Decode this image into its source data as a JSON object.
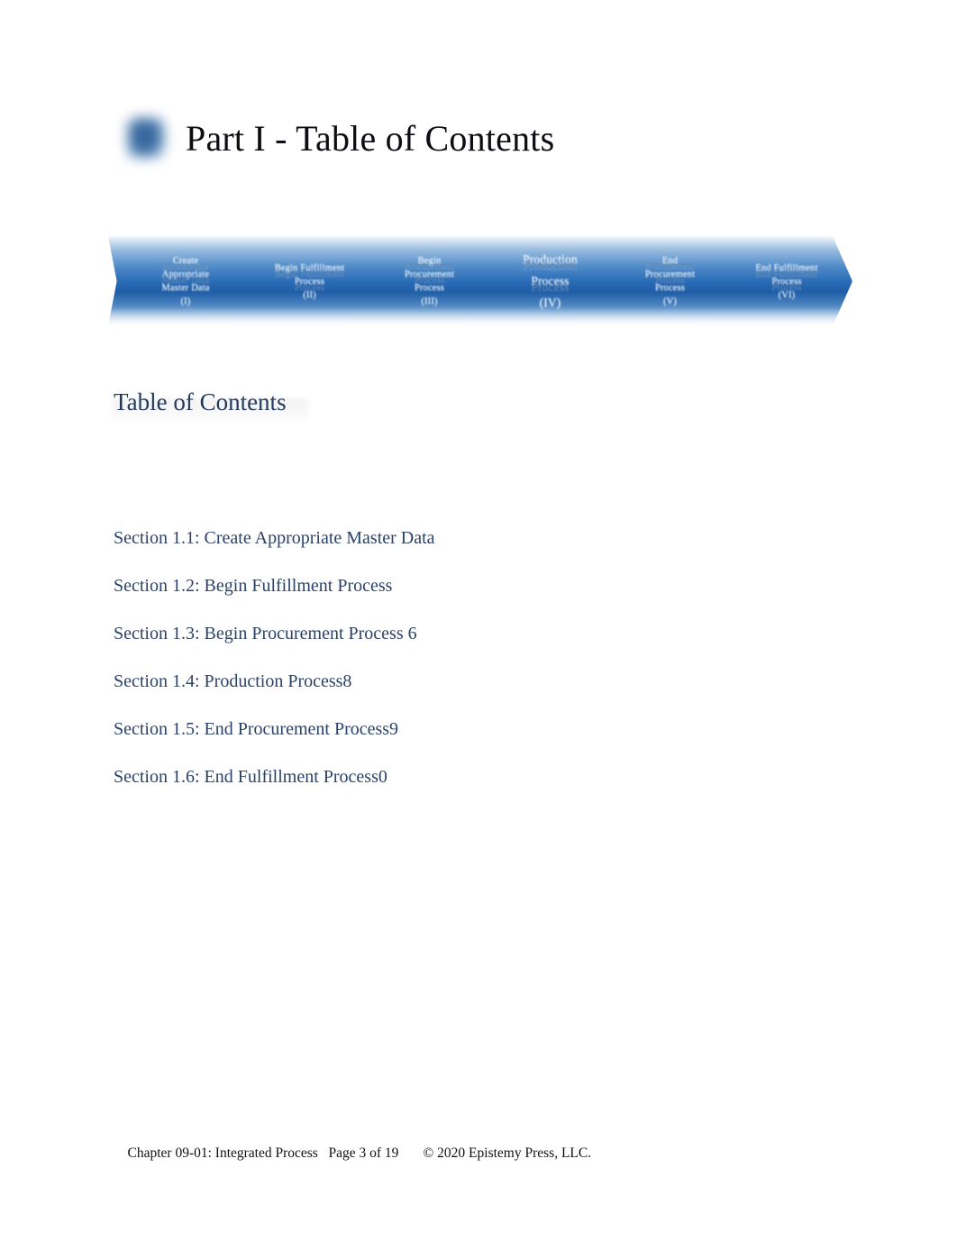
{
  "document": {
    "title": "Part I - Table of Contents",
    "title_icon": "blue-rounded-square-icon"
  },
  "process_flow": {
    "steps": [
      {
        "label": "Create\nAppropriate\nMaster Data\n(I)",
        "line1": "Create",
        "line2": "Appropriate",
        "line3": "Master Data",
        "numeral": "(I)",
        "size": "small"
      },
      {
        "label": "Begin Fulfillment\nProcess\n(II)",
        "line1": "Begin Fulfillment",
        "line2": "Process",
        "line3": "",
        "numeral": "(II)",
        "size": "small"
      },
      {
        "label": "Begin\nProcurement\nProcess\n(III)",
        "line1": "Begin",
        "line2": "Procurement",
        "line3": "Process",
        "numeral": "(III)",
        "size": "small"
      },
      {
        "label": "Production\nProcess\n(IV)",
        "line1": "Production",
        "line2": "Process",
        "line3": "",
        "numeral": "(IV)",
        "size": "large"
      },
      {
        "label": "End\nProcurement\nProcess\n(V)",
        "line1": "End",
        "line2": "Procurement",
        "line3": "Process",
        "numeral": "(V)",
        "size": "small"
      },
      {
        "label": "End Fulfillment\nProcess\n(VI)",
        "line1": "End Fulfillment",
        "line2": "Process",
        "line3": "",
        "numeral": "(VI)",
        "size": "small"
      }
    ],
    "accent_color": "#2a6cb6",
    "text_color": "#ffffff"
  },
  "toc": {
    "heading": "Table of Contents",
    "heading_color": "#23395d",
    "entry_color": "#2b4268",
    "entries": [
      {
        "text": "Section 1.1: Create Appropriate Master Data"
      },
      {
        "text": "Section 1.2: Begin Fulfillment Process"
      },
      {
        "text": "Section 1.3: Begin Procurement Process 6"
      },
      {
        "text": "Section 1.4: Production Process8"
      },
      {
        "text": "Section 1.5: End Procurement Process9"
      },
      {
        "text": "Section 1.6: End Fulfillment Process0"
      }
    ]
  },
  "footer": {
    "chapter": "Chapter 09-01: Integrated Process",
    "gap1": "   ",
    "page": "Page 3 of 19",
    "gap2": "       ",
    "copyright": "© 2020 Epistemy Press, LLC."
  }
}
